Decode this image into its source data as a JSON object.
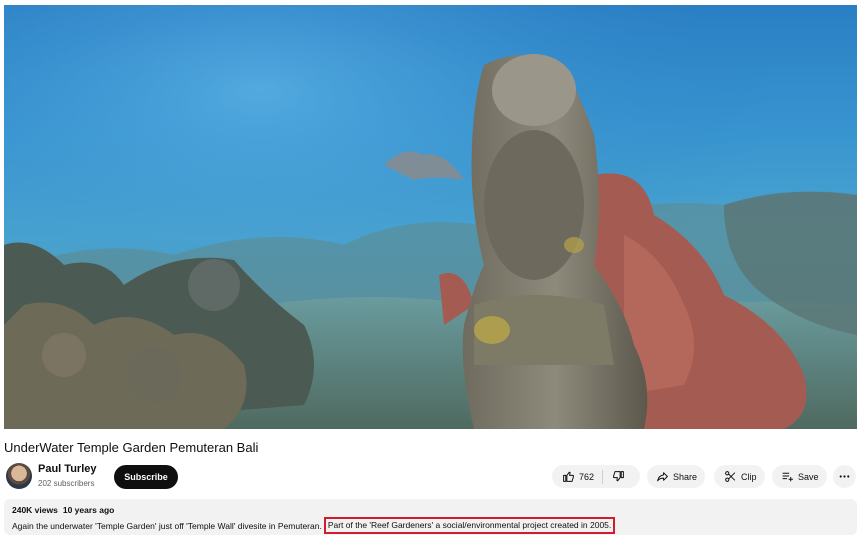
{
  "video": {
    "title": "UnderWater Temple Garden Pemuteran Bali"
  },
  "channel": {
    "name": "Paul Turley",
    "subscribers": "202 subscribers",
    "subscribe_label": "Subscribe"
  },
  "actions": {
    "like_count": "762",
    "share_label": "Share",
    "clip_label": "Clip",
    "save_label": "Save"
  },
  "description": {
    "views": "240K views",
    "age": "10 years ago",
    "text_main": "Again the underwater 'Temple Garden' just off 'Temple Wall' divesite in Pemuteran.",
    "text_highlight": "Part of the 'Reef Gardeners' a social/environmental project created in 2005."
  },
  "colors": {
    "subscribe_bg": "#0f0f0f",
    "pill_bg": "#f2f2f2",
    "highlight_border": "#d21c2b"
  },
  "icons": {
    "like": "thumbs-up-icon",
    "dislike": "thumbs-down-icon",
    "share": "share-arrow-icon",
    "clip": "scissors-icon",
    "save": "playlist-add-icon",
    "more": "more-horizontal-icon"
  }
}
